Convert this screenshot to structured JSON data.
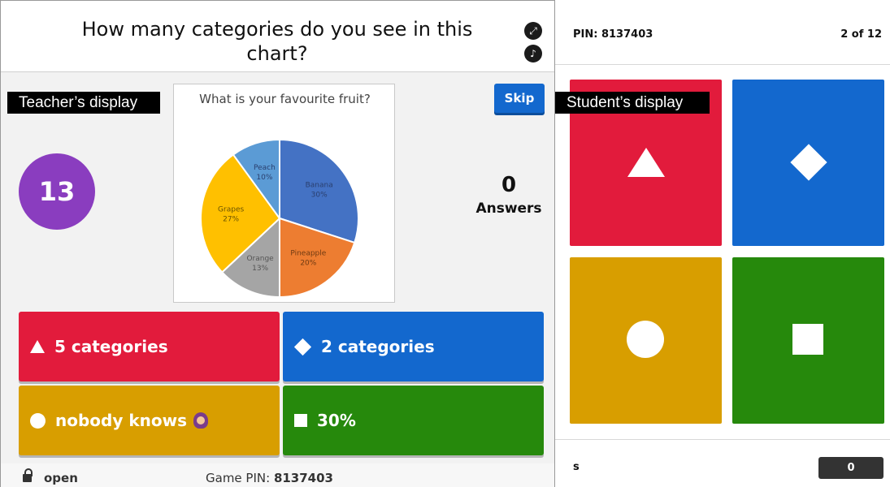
{
  "teacher": {
    "question": "How many categories do you see in this chart?",
    "display_tag": "Teacher’s display",
    "timer": "13",
    "skip_label": "Skip",
    "answers_count": "0",
    "answers_label": "Answers",
    "fullscreen_icon": "fullscreen-icon",
    "sound_icon": "sound-icon",
    "answers": [
      {
        "shape": "triangle",
        "label": "5 categories",
        "color": "#e21b3c"
      },
      {
        "shape": "diamond",
        "label": "2 categories",
        "color": "#1368ce"
      },
      {
        "shape": "circle",
        "label": "nobody knows",
        "color": "#d89e00",
        "emoji": "woman-shrugging-emoji"
      },
      {
        "shape": "square",
        "label": "30%",
        "color": "#26890c"
      }
    ],
    "footer": {
      "lock_icon": "lock-open-icon",
      "status": "open",
      "game_pin_label": "Game PIN: ",
      "game_pin": "8137403"
    }
  },
  "chart_data": {
    "type": "pie",
    "title": "What is your favourite fruit?",
    "categories": [
      "Banana",
      "Pineapple",
      "Orange",
      "Grapes",
      "Peach"
    ],
    "values": [
      30,
      20,
      13,
      27,
      10
    ],
    "labels": [
      "30%",
      "20%",
      "13%",
      "27%",
      "10%"
    ],
    "colors": [
      "#4472c4",
      "#ed7d31",
      "#a5a5a5",
      "#ffc000",
      "#5b9bd5"
    ]
  },
  "student": {
    "display_tag": "Student’s display",
    "pin": "PIN: 8137403",
    "progress": "2 of 12",
    "tiles": [
      {
        "shape": "triangle",
        "color": "#e21b3c"
      },
      {
        "shape": "diamond",
        "color": "#1368ce"
      },
      {
        "shape": "circle",
        "color": "#d89e00"
      },
      {
        "shape": "square",
        "color": "#26890c"
      }
    ],
    "player_name": "s",
    "score": "0"
  }
}
